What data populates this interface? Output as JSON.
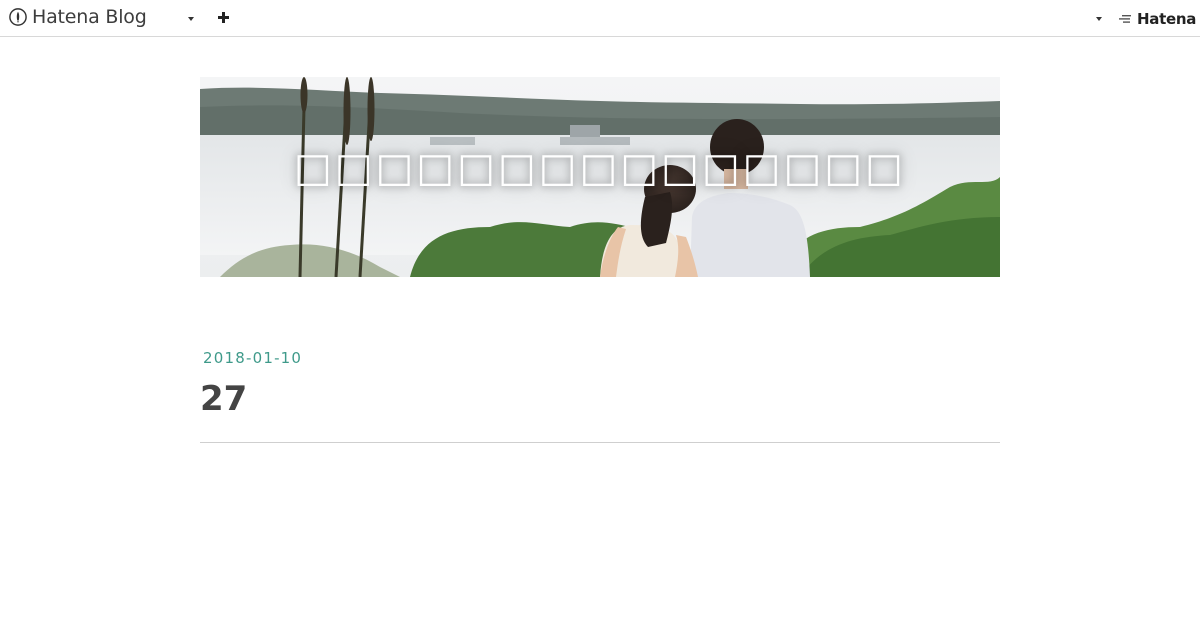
{
  "topbar": {
    "logo_text": "Hatena Blog",
    "brand_text": "Hatena"
  },
  "header": {
    "blog_title": "□□□□□□□□□□□□□□□"
  },
  "entry": {
    "date": "2018-01-10",
    "title": "27"
  },
  "colors": {
    "date_accent": "#3f9a8a",
    "title_text": "#444444"
  }
}
